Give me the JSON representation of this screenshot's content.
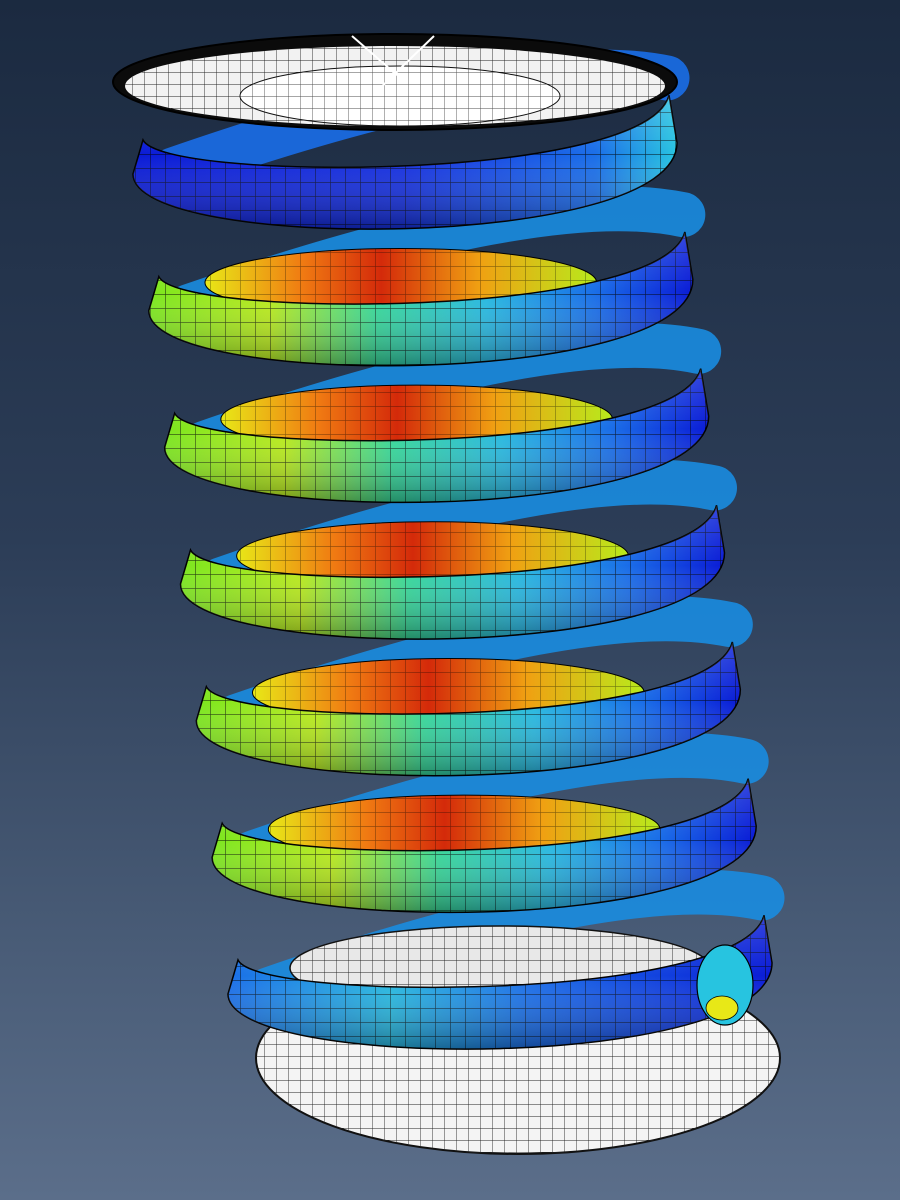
{
  "viewport": {
    "background_top": "#1b2a40",
    "background_bottom": "#5b6e8a"
  },
  "model": {
    "object": "helical-coil-spring",
    "coil_count": 7,
    "rendering": "finite-element-mesh-contour",
    "mesh_line_color": "#000000",
    "plate_color": "#ffffff",
    "contour_colors": [
      "#0a1bd6",
      "#1a6ee8",
      "#27c4e0",
      "#35d79a",
      "#7be61f",
      "#e8e817",
      "#f07a12",
      "#d42a0a"
    ]
  }
}
